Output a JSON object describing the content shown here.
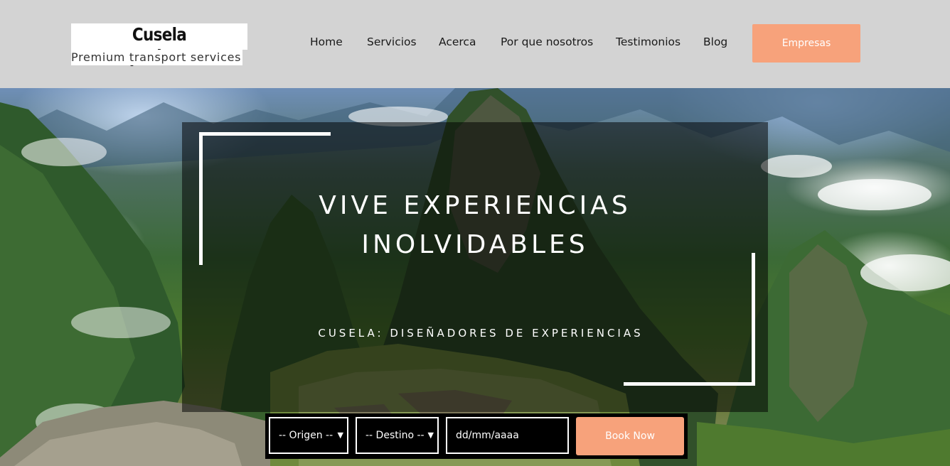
{
  "logo": {
    "title": "Cusela Experiences",
    "subtitle": "Premium transport services"
  },
  "nav": {
    "items": [
      {
        "label": "Home"
      },
      {
        "label": "Servicios"
      },
      {
        "label": "Acerca"
      },
      {
        "label": "Por que nosotros"
      },
      {
        "label": "Testimonios"
      },
      {
        "label": "Blog"
      }
    ],
    "cta_label": "Empresas"
  },
  "hero": {
    "headline_line1": "VIVE EXPERIENCIAS",
    "headline_line2": "INOLVIDABLES",
    "subheadline": "CUSELA: DISEÑADORES DE EXPERIENCIAS"
  },
  "booking": {
    "origin_selected": "-- Origen --",
    "destination_selected": "-- Destino --",
    "date_placeholder": "dd/mm/aaaa",
    "submit_label": "Book Now"
  },
  "colors": {
    "accent": "#f7a27b",
    "header_bg": "#d3d3d3",
    "overlay": "rgba(0,0,0,0.52)"
  }
}
